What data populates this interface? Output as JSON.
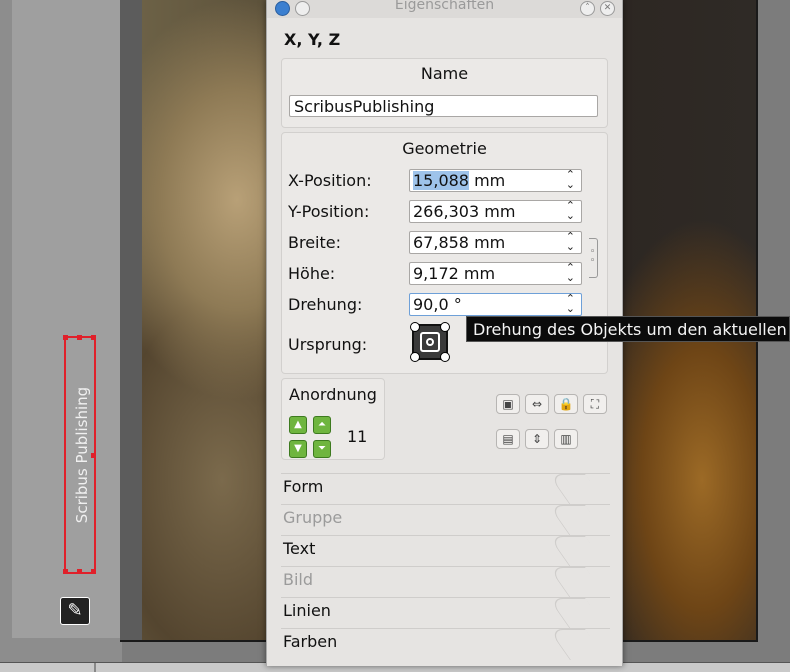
{
  "dialog": {
    "title": "Eigenschaften",
    "active_tab": "X, Y, Z"
  },
  "name_group": {
    "title": "Name",
    "value": "ScribusPublishing"
  },
  "geometry": {
    "title": "Geometrie",
    "x_label": "X-Position:",
    "x_value": "15,088",
    "x_unit": " mm",
    "y_label": "Y-Position:",
    "y_value": "266,303 mm",
    "width_label": "Breite:",
    "width_value": "67,858 mm",
    "height_label": "Höhe:",
    "height_value": "9,172 mm",
    "rotation_label": "Drehung:",
    "rotation_value": "90,0 °",
    "origin_label": "Ursprung:"
  },
  "tooltip": {
    "text": "Drehung des Objekts um den aktuellen U"
  },
  "arrangement": {
    "title": "Anordnung",
    "level": "11"
  },
  "sections": [
    {
      "label": "Form",
      "enabled": true
    },
    {
      "label": "Gruppe",
      "enabled": false
    },
    {
      "label": "Text",
      "enabled": true
    },
    {
      "label": "Bild",
      "enabled": false
    },
    {
      "label": "Linien",
      "enabled": true
    },
    {
      "label": "Farben",
      "enabled": true
    }
  ],
  "canvas": {
    "frame_text": "Scribus Publishing"
  },
  "icons": {
    "close": "close-icon",
    "shade": "shade-icon",
    "origin": "origin-selector-icon",
    "chain": "chain-link-icon"
  },
  "colors": {
    "selection_frame": "#e0202a",
    "text_highlight": "#9ec3ea",
    "level_arrows": "#6fb53f"
  }
}
